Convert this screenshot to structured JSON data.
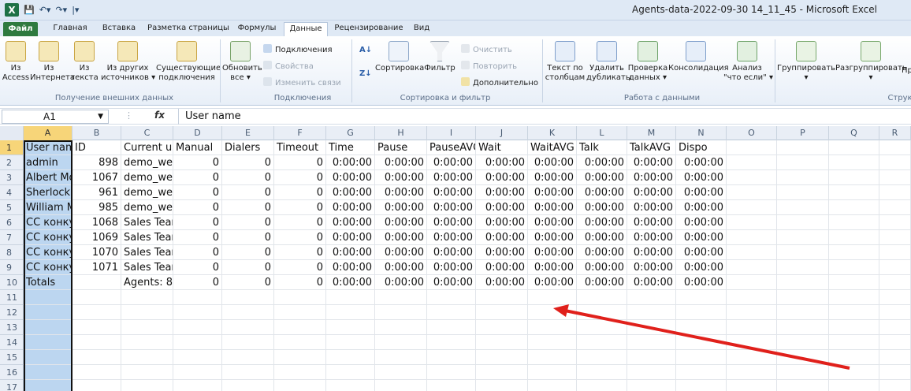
{
  "window": {
    "title": "Agents-data-2022-09-30 14_11_45  -  Microsoft Excel",
    "app_icon": "X",
    "quick_access": [
      "save-icon",
      "undo-icon",
      "redo-icon",
      "customize-icon"
    ]
  },
  "tabs": [
    "Файл",
    "Главная",
    "Вставка",
    "Разметка страницы",
    "Формулы",
    "Данные",
    "Рецензирование",
    "Вид"
  ],
  "active_tab": "Данные",
  "ribbon": {
    "external": {
      "access": [
        "Из",
        "Access"
      ],
      "web": [
        "Из",
        "Интернета"
      ],
      "text": [
        "Из",
        "текста"
      ],
      "other": [
        "Из других",
        "источников ▾"
      ],
      "existing": [
        "Существующие",
        "подключения"
      ],
      "title": "Получение внешних данных"
    },
    "connections": {
      "refresh": [
        "Обновить",
        "все ▾"
      ],
      "connections": "Подключения",
      "properties": "Свойства",
      "edit_links": "Изменить связи",
      "title": "Подключения"
    },
    "sort": {
      "sort": "Сортировка",
      "filter": "Фильтр",
      "clear": "Очистить",
      "reapply": "Повторить",
      "advanced": "Дополнительно",
      "title": "Сортировка и фильтр"
    },
    "datatools": {
      "text_to_cols": [
        "Текст по",
        "столбцам"
      ],
      "remove_dups": [
        "Удалить",
        "дубликаты"
      ],
      "validation": [
        "Проверка",
        "данных ▾"
      ],
      "consolidate": "Консолидация",
      "whatif": [
        "Анализ",
        "\"что если\" ▾"
      ],
      "title": "Работа с данными"
    },
    "outline": {
      "group": "Группировать",
      "ungroup": "Разгруппировать",
      "more": "Пр",
      "title": "Струк"
    }
  },
  "formula_bar": {
    "name_box": "A1",
    "fx": "fx",
    "value": "User name"
  },
  "columns": [
    "A",
    "B",
    "C",
    "D",
    "E",
    "F",
    "G",
    "H",
    "I",
    "J",
    "K",
    "L",
    "M",
    "N",
    "O",
    "P",
    "Q",
    "R"
  ],
  "row_numbers": [
    "1",
    "2",
    "3",
    "4",
    "5",
    "6",
    "7",
    "8",
    "9",
    "10",
    "11",
    "12",
    "13",
    "14",
    "15",
    "16",
    "17"
  ],
  "headers": [
    "User name",
    "ID",
    "Current us",
    "Manual",
    "Dialers",
    "Timeout",
    "Time",
    "Pause",
    "PauseAVG",
    "Wait",
    "WaitAVG",
    "Talk",
    "TalkAVG",
    "Dispo"
  ],
  "rows": [
    [
      "admin",
      "898",
      "demo_wel",
      "0",
      "0",
      "0",
      "0:00:00",
      "0:00:00",
      "0:00:00",
      "0:00:00",
      "0:00:00",
      "0:00:00",
      "0:00:00",
      "0:00:00"
    ],
    [
      "Albert Mo",
      "1067",
      "demo_wel",
      "0",
      "0",
      "0",
      "0:00:00",
      "0:00:00",
      "0:00:00",
      "0:00:00",
      "0:00:00",
      "0:00:00",
      "0:00:00",
      "0:00:00"
    ],
    [
      "Sherlock H",
      "961",
      "demo_wel",
      "0",
      "0",
      "0",
      "0:00:00",
      "0:00:00",
      "0:00:00",
      "0:00:00",
      "0:00:00",
      "0:00:00",
      "0:00:00",
      "0:00:00"
    ],
    [
      "William M",
      "985",
      "demo_wel",
      "0",
      "0",
      "0",
      "0:00:00",
      "0:00:00",
      "0:00:00",
      "0:00:00",
      "0:00:00",
      "0:00:00",
      "0:00:00",
      "0:00:00"
    ],
    [
      "CC конкур",
      "1068",
      "Sales Tean",
      "0",
      "0",
      "0",
      "0:00:00",
      "0:00:00",
      "0:00:00",
      "0:00:00",
      "0:00:00",
      "0:00:00",
      "0:00:00",
      "0:00:00"
    ],
    [
      "CC конкур",
      "1069",
      "Sales Tean",
      "0",
      "0",
      "0",
      "0:00:00",
      "0:00:00",
      "0:00:00",
      "0:00:00",
      "0:00:00",
      "0:00:00",
      "0:00:00",
      "0:00:00"
    ],
    [
      "CC конкур",
      "1070",
      "Sales Tean",
      "0",
      "0",
      "0",
      "0:00:00",
      "0:00:00",
      "0:00:00",
      "0:00:00",
      "0:00:00",
      "0:00:00",
      "0:00:00",
      "0:00:00"
    ],
    [
      "CC конкур",
      "1071",
      "Sales Tean",
      "0",
      "0",
      "0",
      "0:00:00",
      "0:00:00",
      "0:00:00",
      "0:00:00",
      "0:00:00",
      "0:00:00",
      "0:00:00",
      "0:00:00"
    ],
    [
      "Totals",
      "",
      "Agents: 8",
      "0",
      "0",
      "0",
      "0:00:00",
      "0:00:00",
      "0:00:00",
      "0:00:00",
      "0:00:00",
      "0:00:00",
      "0:00:00",
      "0:00:00"
    ]
  ],
  "colors": {
    "excel_green": "#1e7145",
    "selection": "#bcd6f0",
    "header_highlight": "#f7d579",
    "annotation_arrow": "#e0201b"
  }
}
